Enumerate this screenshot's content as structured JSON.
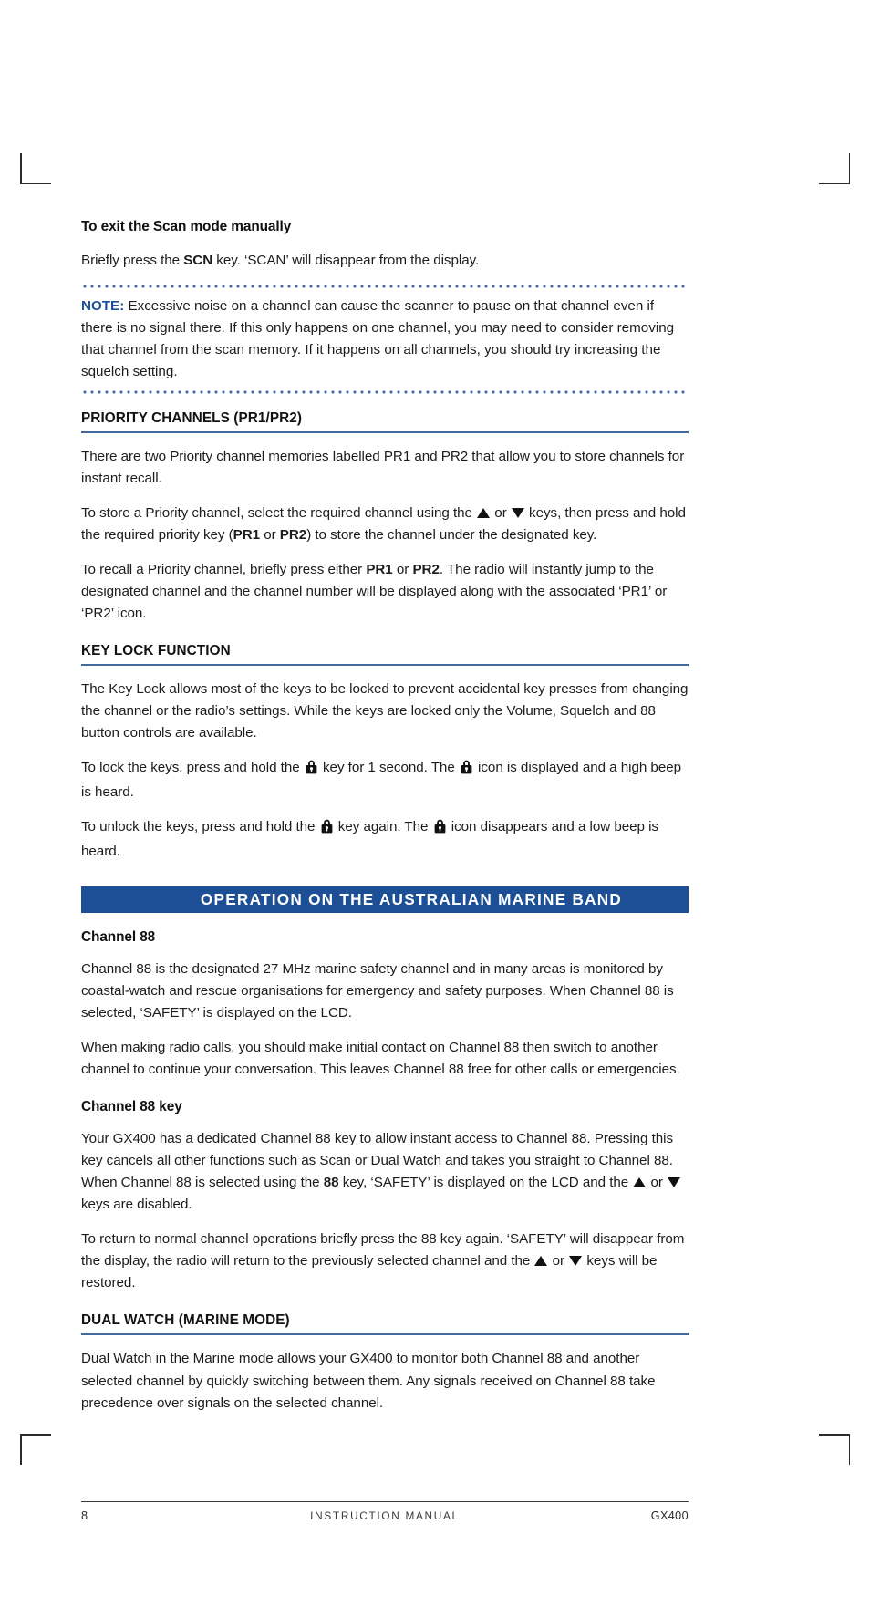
{
  "document": {
    "title": "GX400 Instruction Manual",
    "page_number": "8",
    "footer_center": "INSTRUCTION MANUAL",
    "footer_right": "GX400"
  },
  "colors": {
    "banner_blue": "#1c4f96",
    "note_blue": "#1c4f96",
    "dotted_rule_blue": "#3f6fb5",
    "heading_underline": "#43679f",
    "text": "#1c1c1c"
  },
  "content": {
    "scan_exit": {
      "heading": "To exit the Scan mode manually",
      "paragraph_pre": "Briefly press the ",
      "paragraph_key": "SCN",
      "paragraph_post": " key. ‘SCAN’ will disappear from the display."
    },
    "note": {
      "label": "NOTE:",
      "text": " Excessive noise on a channel can cause the scanner to pause on that channel even if there is no signal there. If this only happens on one channel, you may need to consider removing that channel from the scan memory. If it happens on all channels, you should try increasing the squelch setting."
    },
    "priority": {
      "heading": "PRIORITY CHANNELS (PR1/PR2)",
      "p1": "There are two Priority channel memories labelled PR1 and PR2 that allow you to store channels for instant recall.",
      "p2_a": "To store a Priority channel, select the required channel using the ",
      "p2_b": " or ",
      "p2_c": " keys, then press and hold the required priority key (",
      "p2_key1": "PR1",
      "p2_d": " or ",
      "p2_key2": "PR2",
      "p2_e": ") to store the channel under the designated key.",
      "p3_a": "To recall a Priority channel, briefly press either ",
      "p3_key1": "PR1",
      "p3_b": " or ",
      "p3_key2": "PR2",
      "p3_c": ". The radio will instantly jump to the designated channel and the channel number will be displayed along with the associated ‘PR1’ or ‘PR2’ icon."
    },
    "key_lock": {
      "heading": "KEY LOCK FUNCTION",
      "p1": "The Key Lock allows most of the keys to be locked to prevent accidental key presses from changing the channel or the radio’s settings. While the keys are locked only the Volume, Squelch and 88 button controls are available.",
      "p2_a": "To lock the keys, press and hold the ",
      "p2_b": " key for 1 second. The ",
      "p2_c": " icon is displayed and a high beep is heard.",
      "p3_a": "To unlock the keys, press and hold the ",
      "p3_b": " key again. The ",
      "p3_c": " icon disappears and a low beep is heard."
    },
    "banner": {
      "label": "OPERATION ON THE AUSTRALIAN MARINE BAND"
    },
    "channel88": {
      "heading": "Channel 88",
      "p1": "Channel 88 is the designated 27 MHz marine safety channel and in many areas is monitored by coastal-watch and rescue organisations for emergency and safety purposes. When Channel 88 is selected, ‘SAFETY’ is displayed on the LCD.",
      "p2": "When making radio calls, you should make initial contact on Channel 88 then switch to another channel to continue your conversation. This leaves Channel 88 free for other calls or emergencies."
    },
    "channel88_key": {
      "heading": "Channel 88 key",
      "p1_a": "Your GX400 has a dedicated Channel 88 key to allow instant access to Channel 88. Pressing this key cancels all other functions such as Scan or Dual Watch and takes you straight to Channel 88. When Channel 88 is selected using the ",
      "p1_key": "88",
      "p1_b": " key, ‘SAFETY’ is displayed on the LCD and the ",
      "p1_c": " or ",
      "p1_d": " keys are disabled.",
      "p2_a": "To return to normal channel operations briefly press the 88 key again. ‘SAFETY’ will disappear from the display, the radio will return to the previously selected channel and the ",
      "p2_b": " or ",
      "p2_c": " keys will be restored."
    },
    "dual_watch": {
      "heading": "DUAL WATCH (MARINE MODE)",
      "p1": "Dual Watch in the Marine mode allows your GX400 to monitor both Channel 88 and another selected channel by quickly switching between them. Any signals received on Channel 88 take precedence over signals on the selected channel."
    }
  }
}
